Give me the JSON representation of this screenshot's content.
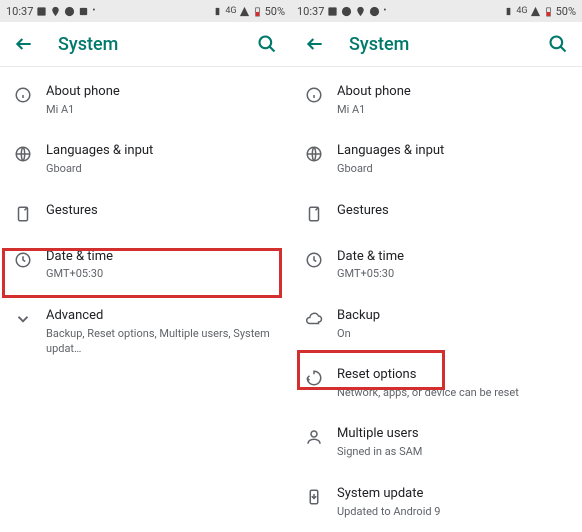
{
  "status": {
    "time": "10:37",
    "network_label": "4G",
    "battery": "50%"
  },
  "app_bar": {
    "title": "System"
  },
  "left": {
    "items": {
      "about": {
        "title": "About phone",
        "sub": "Mi A1"
      },
      "languages": {
        "title": "Languages & input",
        "sub": "Gboard"
      },
      "gestures": {
        "title": "Gestures"
      },
      "datetime": {
        "title": "Date & time",
        "sub": "GMT+05:30"
      },
      "advanced": {
        "title": "Advanced",
        "sub": "Backup, Reset options, Multiple users, System updat…"
      }
    }
  },
  "right": {
    "items": {
      "about": {
        "title": "About phone",
        "sub": "Mi A1"
      },
      "languages": {
        "title": "Languages & input",
        "sub": "Gboard"
      },
      "gestures": {
        "title": "Gestures"
      },
      "datetime": {
        "title": "Date & time",
        "sub": "GMT+05:30"
      },
      "backup": {
        "title": "Backup",
        "sub": "On"
      },
      "reset": {
        "title": "Reset options",
        "sub": "Network, apps, or device can be reset"
      },
      "multiuser": {
        "title": "Multiple users",
        "sub": "Signed in as SAM"
      },
      "sysupdate": {
        "title": "System update",
        "sub": "Updated to Android 9"
      }
    }
  }
}
